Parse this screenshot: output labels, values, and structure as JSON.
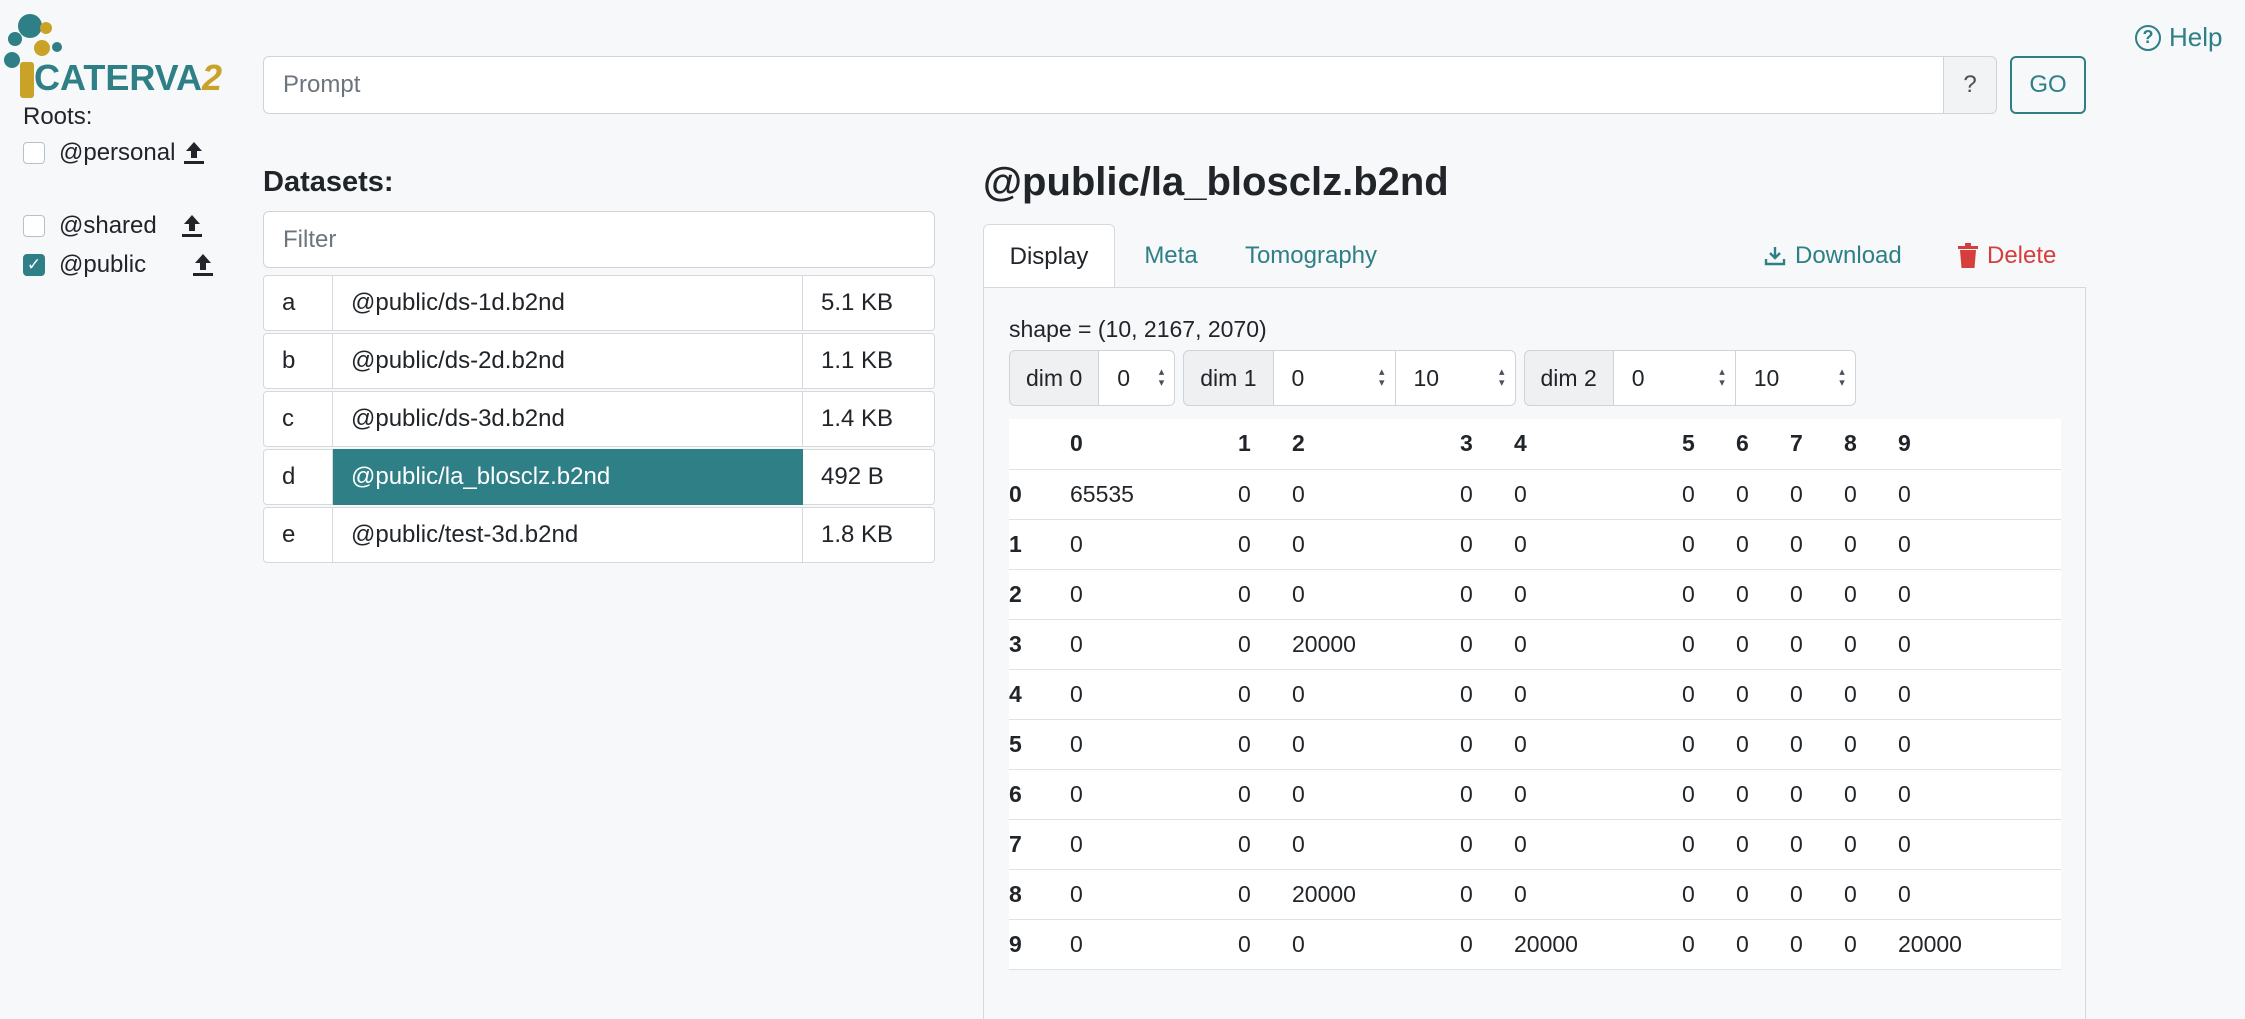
{
  "brand": {
    "name": "CATERVA",
    "suffix": "2"
  },
  "help": {
    "label": "Help"
  },
  "roots": {
    "title": "Roots:",
    "items": [
      {
        "label": "@personal",
        "checked": false
      },
      {
        "label": "@shared",
        "checked": false
      },
      {
        "label": "@public",
        "checked": true
      }
    ]
  },
  "prompt": {
    "placeholder": "Prompt",
    "help_label": "?",
    "go_label": "GO"
  },
  "datasets": {
    "title": "Datasets:",
    "filter_placeholder": "Filter",
    "rows": [
      {
        "key": "a",
        "path": "@public/ds-1d.b2nd",
        "size": "5.1 KB"
      },
      {
        "key": "b",
        "path": "@public/ds-2d.b2nd",
        "size": "1.1 KB"
      },
      {
        "key": "c",
        "path": "@public/ds-3d.b2nd",
        "size": "1.4 KB"
      },
      {
        "key": "d",
        "path": "@public/la_blosclz.b2nd",
        "size": "492 B"
      },
      {
        "key": "e",
        "path": "@public/test-3d.b2nd",
        "size": "1.8 KB"
      }
    ],
    "active_index": 3
  },
  "detail": {
    "title": "@public/la_blosclz.b2nd",
    "tabs": [
      "Display",
      "Meta",
      "Tomography"
    ],
    "active_tab": "Display",
    "download_label": "Download",
    "delete_label": "Delete",
    "shape_text": "shape = (10, 2167, 2070)",
    "dims": [
      {
        "label": "dim 0",
        "values": [
          "0"
        ]
      },
      {
        "label": "dim 1",
        "values": [
          "0",
          "10"
        ]
      },
      {
        "label": "dim 2",
        "values": [
          "0",
          "10"
        ]
      }
    ],
    "table": {
      "columns": [
        "0",
        "1",
        "2",
        "3",
        "4",
        "5",
        "6",
        "7",
        "8",
        "9"
      ],
      "rows": [
        {
          "index": "0",
          "cells": [
            "65535",
            "0",
            "0",
            "0",
            "0",
            "0",
            "0",
            "0",
            "0",
            "0"
          ]
        },
        {
          "index": "1",
          "cells": [
            "0",
            "0",
            "0",
            "0",
            "0",
            "0",
            "0",
            "0",
            "0",
            "0"
          ]
        },
        {
          "index": "2",
          "cells": [
            "0",
            "0",
            "0",
            "0",
            "0",
            "0",
            "0",
            "0",
            "0",
            "0"
          ]
        },
        {
          "index": "3",
          "cells": [
            "0",
            "0",
            "20000",
            "0",
            "0",
            "0",
            "0",
            "0",
            "0",
            "0"
          ]
        },
        {
          "index": "4",
          "cells": [
            "0",
            "0",
            "0",
            "0",
            "0",
            "0",
            "0",
            "0",
            "0",
            "0"
          ]
        },
        {
          "index": "5",
          "cells": [
            "0",
            "0",
            "0",
            "0",
            "0",
            "0",
            "0",
            "0",
            "0",
            "0"
          ]
        },
        {
          "index": "6",
          "cells": [
            "0",
            "0",
            "0",
            "0",
            "0",
            "0",
            "0",
            "0",
            "0",
            "0"
          ]
        },
        {
          "index": "7",
          "cells": [
            "0",
            "0",
            "0",
            "0",
            "0",
            "0",
            "0",
            "0",
            "0",
            "0"
          ]
        },
        {
          "index": "8",
          "cells": [
            "0",
            "0",
            "20000",
            "0",
            "0",
            "0",
            "0",
            "0",
            "0",
            "0"
          ]
        },
        {
          "index": "9",
          "cells": [
            "0",
            "0",
            "0",
            "0",
            "20000",
            "0",
            "0",
            "0",
            "0",
            "20000"
          ]
        }
      ]
    }
  },
  "colors": {
    "accent": "#2e7f86",
    "brand_gold": "#c9a227",
    "danger": "#d63e3e"
  },
  "icons": {
    "upload": "upload-icon",
    "download": "download-icon",
    "delete": "trash-icon",
    "help": "question-circle-icon"
  }
}
